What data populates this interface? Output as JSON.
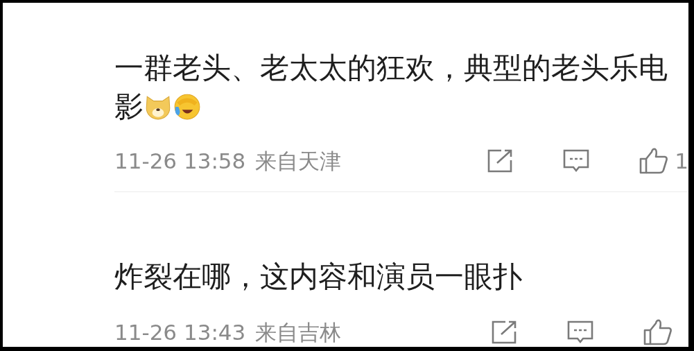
{
  "comments": [
    {
      "lines": [
        "一群老头、老太太的狂欢，典型的老头乐电",
        "影"
      ],
      "emojis": [
        {
          "kind": "dog"
        },
        {
          "kind": "laugh-cry"
        }
      ],
      "time": "11-26 13:58",
      "location": "来自天津",
      "likes": "1"
    },
    {
      "lines": [
        "炸裂在哪，这内容和演员一眼扑"
      ],
      "time": "11-26 13:43",
      "location": "来自吉林"
    }
  ]
}
